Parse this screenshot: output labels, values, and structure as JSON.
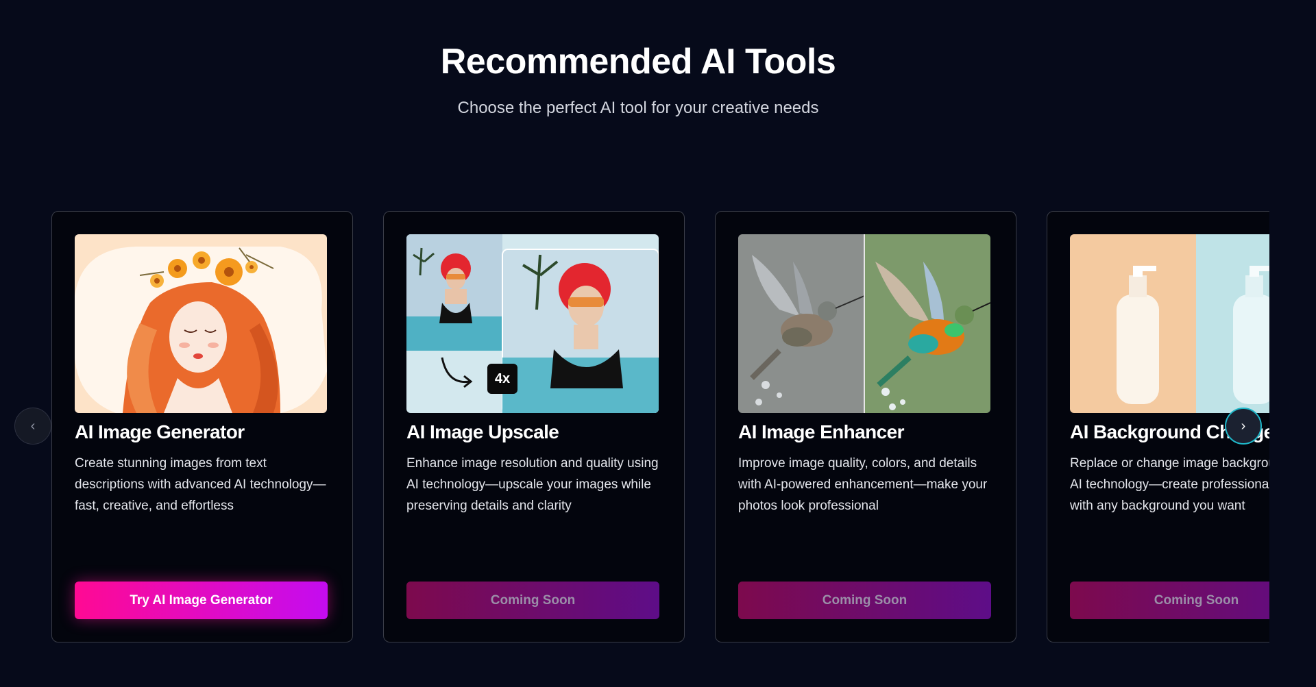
{
  "header": {
    "title": "Recommended AI Tools",
    "subtitle": "Choose the perfect AI tool for your creative needs"
  },
  "carousel": {
    "prev_icon": "chevron-left-icon",
    "next_icon": "chevron-right-icon",
    "prev_glyph": "‹",
    "next_glyph": "›",
    "cards": [
      {
        "title": "AI Image Generator",
        "description": "Create stunning images from text descriptions with advanced AI technology—fast, creative, and effortless",
        "button_label": "Try AI Image Generator",
        "button_state": "active",
        "image": "illustrated woman with orange hair and flower crown"
      },
      {
        "title": "AI Image Upscale",
        "description": "Enhance image resolution and quality using AI technology—upscale your images while preserving details and clarity",
        "button_label": "Coming Soon",
        "button_state": "disabled",
        "image": "before/after photo of woman with red hair and sunglasses",
        "badge": "4x"
      },
      {
        "title": "AI Image Enhancer",
        "description": "Improve image quality, colors, and details with AI-powered enhancement—make your photos look professional",
        "button_label": "Coming Soon",
        "button_state": "disabled",
        "image": "before/after hummingbird photo"
      },
      {
        "title": "AI Background Changer",
        "description": "Replace or change image background with AI technology—create professional photos with any background you want",
        "button_label": "Coming Soon",
        "button_state": "disabled",
        "image": "white bottles on peach and light blue backgrounds"
      }
    ]
  },
  "colors": {
    "background": "#060a1a",
    "accent_pink": "#ff0a93",
    "accent_purple": "#c40cf0",
    "nav_ring": "#1fb7c9"
  }
}
